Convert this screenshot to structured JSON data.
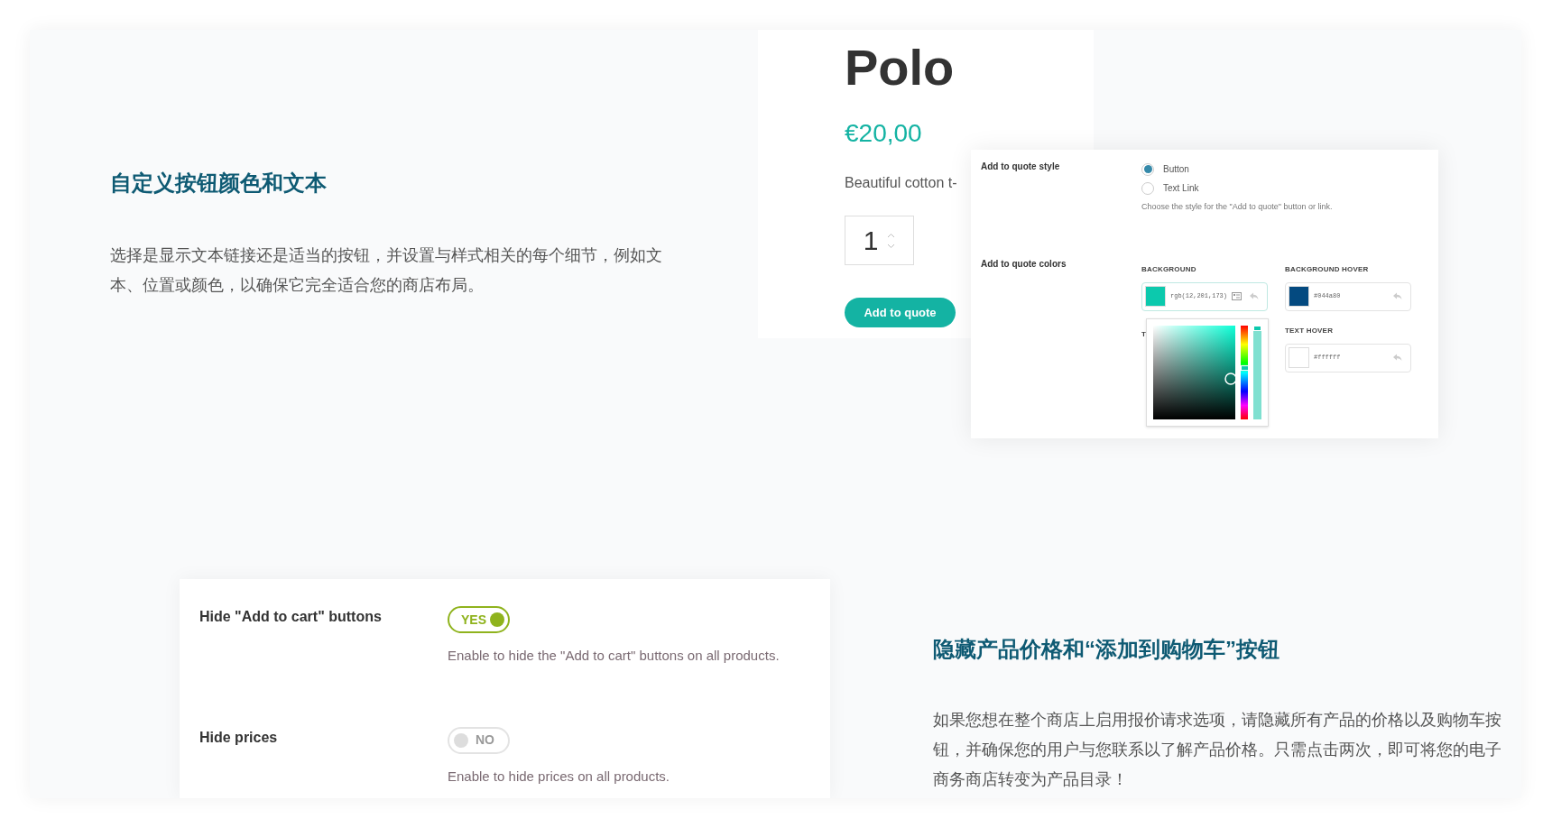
{
  "features": [
    {
      "title": "自定义按钮颜色和文本",
      "description": "选择是显示文本链接还是适当的按钮，并设置与样式相关的每个细节，例如文本、位置或颜色，以确保它完全适合您的商店布局。"
    },
    {
      "title": "隐藏产品价格和“添加到购物车”按钮",
      "description": "如果您想在整个商店上启用报价请求选项，请隐藏所有产品的价格以及购物车按钮，并确保您的用户与您联系以了解产品价格。只需点击两次，即可将您的电子商务商店转变为产品目录！"
    }
  ],
  "product": {
    "title": "Polo",
    "price": "€20,00",
    "description": "Beautiful cotton t-",
    "quantity": "1",
    "button": "Add to quote"
  },
  "style_settings": {
    "style_label": "Add to quote style",
    "style_options": [
      {
        "label": "Button",
        "selected": true
      },
      {
        "label": "Text Link",
        "selected": false
      }
    ],
    "style_help": "Choose the style for the \"Add to quote\" button or link.",
    "colors_label": "Add to quote colors",
    "colors": [
      {
        "label": "BACKGROUND",
        "value": "rgb(12,201,173)",
        "color": "#0cc9ad",
        "picker_open": true
      },
      {
        "label": "BACKGROUND HOVER",
        "value": "#044a80",
        "color": "#044a80",
        "picker_open": false
      },
      {
        "label": "TEXT HOVER",
        "value": "#ffffff",
        "color": "#ffffff",
        "picker_open": false
      }
    ],
    "covered_label": "T",
    "picker": {
      "hue": {
        "level": 0.55
      },
      "opacity": {
        "level": 1
      }
    }
  },
  "toggles": [
    {
      "label": "Hide \"Add to cart\" buttons",
      "on": true,
      "state_text": "YES",
      "help": "Enable to hide the \"Add to cart\" buttons on all products."
    },
    {
      "label": "Hide prices",
      "on": false,
      "state_text": "NO",
      "help": "Enable to hide prices on all products."
    }
  ]
}
